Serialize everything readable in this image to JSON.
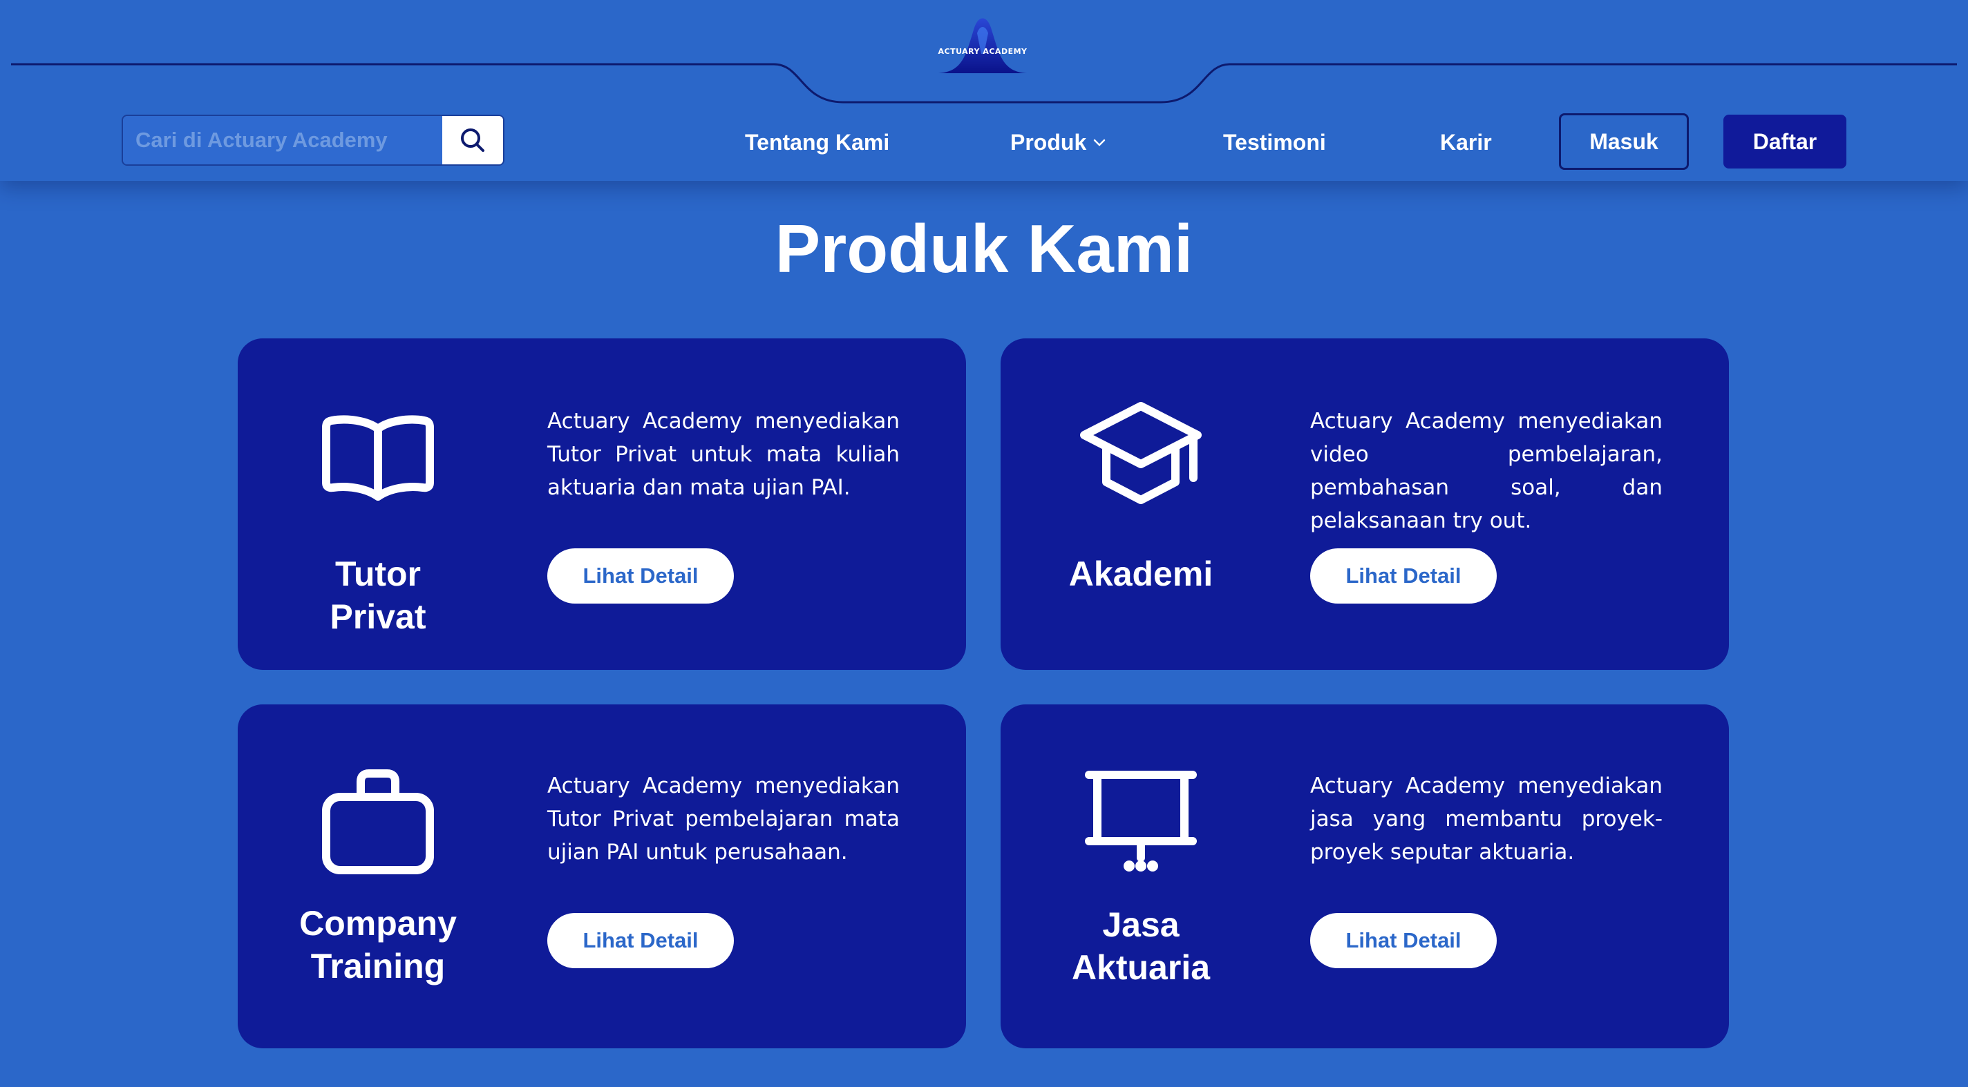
{
  "header": {
    "logo_text": "ACTUARY ACADEMY",
    "search": {
      "placeholder": "Cari di Actuary Academy",
      "value": "",
      "icon": "search-icon"
    },
    "nav": {
      "about": "Tentang Kami",
      "products": "Produk",
      "products_icon": "chevron-down-icon",
      "testimonials": "Testimoni",
      "careers": "Karir"
    },
    "login_label": "Masuk",
    "register_label": "Daftar"
  },
  "main": {
    "title": "Produk Kami",
    "cards": [
      {
        "name": "Tutor Privat",
        "icon": "book-open-icon",
        "description": "Actuary Academy menyediakan Tutor Privat untuk mata kuliah aktuaria dan mata ujian PAI.",
        "button_label": "Lihat Detail"
      },
      {
        "name": "Akademi",
        "icon": "graduation-cap-icon",
        "description": "Actuary Academy menyediakan video pembelajaran, pembahasan soal, dan pelaksanaan try out.",
        "button_label": "Lihat Detail"
      },
      {
        "name": "Company Training",
        "icon": "briefcase-icon",
        "description": "Actuary Academy menyediakan Tutor Privat pembelajaran mata ujian PAI untuk perusahaan.",
        "button_label": "Lihat Detail"
      },
      {
        "name": "Jasa Aktuaria",
        "icon": "presentation-board-icon",
        "description": "Actuary Academy menyediakan jasa yang membantu proyek-proyek seputar aktuaria.",
        "button_label": "Lihat Detail"
      }
    ]
  },
  "colors": {
    "background": "#2b67c9",
    "card": "#0f1b98",
    "register_button": "#101a9a",
    "header_line": "#0d1a6e"
  }
}
